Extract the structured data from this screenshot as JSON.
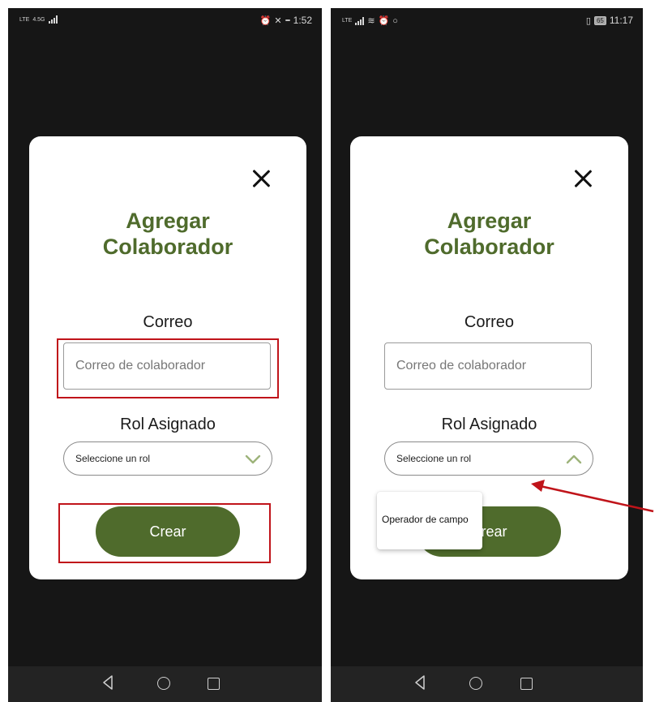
{
  "colors": {
    "brand_green": "#4f6b2c",
    "highlight_red": "#c0141a",
    "phone_background": "#161616"
  },
  "screens": [
    {
      "statusbar": {
        "network": "4.5G",
        "carrier": "LTE",
        "time": "1:52",
        "battery": ""
      },
      "modal": {
        "title_line1": "Agregar",
        "title_line2": "Colaborador",
        "email_label": "Correo",
        "email_placeholder": "Correo de colaborador",
        "role_label": "Rol Asignado",
        "role_select_value": "Seleccione un rol",
        "role_select_state": "collapsed",
        "create_label": "Crear"
      }
    },
    {
      "statusbar": {
        "carrier": "LTE",
        "time": "11:17",
        "battery": "65"
      },
      "modal": {
        "title_line1": "Agregar",
        "title_line2": "Colaborador",
        "email_label": "Correo",
        "email_placeholder": "Correo de colaborador",
        "role_label": "Rol Asignado",
        "role_select_value": "Seleccione un rol",
        "role_select_state": "expanded",
        "create_label": "Crear",
        "dropdown_options": [
          "Operador de campo"
        ]
      }
    }
  ],
  "icons": [
    "close-icon",
    "chevron-down-icon",
    "chevron-up-icon",
    "nav-back-icon",
    "nav-home-icon",
    "nav-recent-icon",
    "annotation-arrow"
  ]
}
